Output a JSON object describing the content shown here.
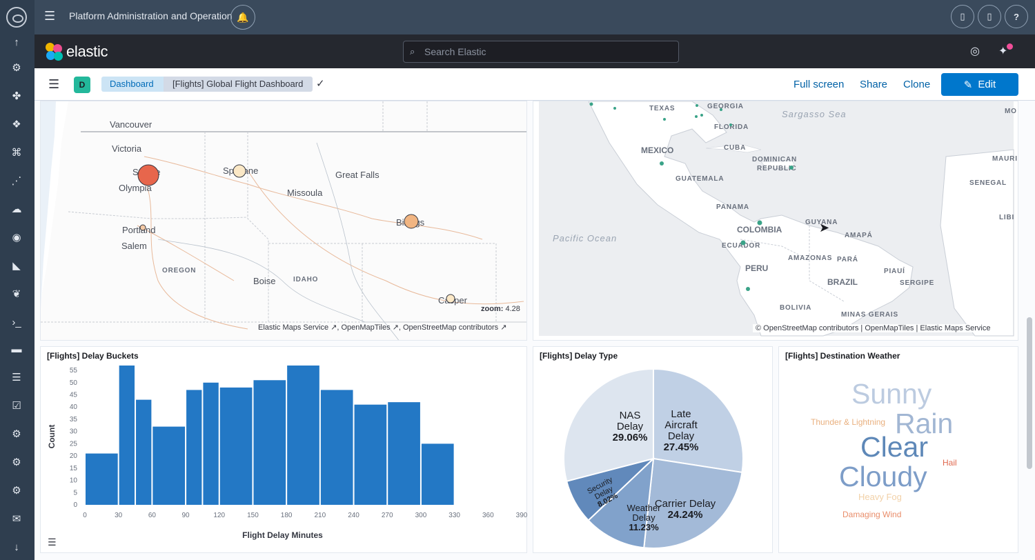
{
  "shell": {
    "title": "Platform Administration and Operation",
    "sidebar_icons": [
      "arrow-up-icon",
      "gear-icon",
      "puzzle-icon",
      "network-icon",
      "graph-icon",
      "share-icon",
      "cloud-icon",
      "target-icon",
      "kibana-icon",
      "leaf-icon",
      "terminal-icon",
      "folder-icon",
      "storage-icon",
      "check-icon",
      "settings-icon",
      "settings-icon",
      "settings-icon",
      "mail-icon",
      "arrow-down-icon"
    ],
    "right_buttons": [
      "document-icon",
      "document-icon",
      "help-icon"
    ],
    "help_label": "?"
  },
  "header": {
    "brand": "elastic",
    "search_placeholder": "Search Elastic"
  },
  "breadcrumbs": {
    "space_initial": "D",
    "items": [
      "Dashboard",
      "[Flights] Global Flight Dashboard"
    ]
  },
  "actions": {
    "full_screen": "Full screen",
    "share": "Share",
    "clone": "Clone",
    "edit": "Edit"
  },
  "map_left": {
    "cities": [
      "Vancouver",
      "Victoria",
      "Seattle",
      "Olympia",
      "Spokane",
      "Great Falls",
      "Missoula",
      "Portland",
      "Salem",
      "Billings",
      "Boise",
      "Casper"
    ],
    "states": [
      "OREGON",
      "IDAHO"
    ],
    "zoom_label": "zoom:",
    "zoom_value": "4.28",
    "attribution": [
      "Elastic Maps Service",
      "OpenMapTiles",
      "OpenStreetMap contributors"
    ]
  },
  "map_right": {
    "labels": [
      "TEXAS",
      "GEORGIA",
      "FLORIDA",
      "MEXICO",
      "CUBA",
      "DOMINICAN",
      "REPUBLIC",
      "GUATEMALA",
      "PANAMA",
      "COLOMBIA",
      "ECUADOR",
      "PERU",
      "AMAZONAS",
      "PARÁ",
      "BRAZIL",
      "GUYANA",
      "AMAPÁ",
      "PIAUÍ",
      "SERGIPE",
      "BOLIVIA",
      "MINAS GERAIS",
      "SENEGAL",
      "MAURI",
      "LIBI",
      "MO"
    ],
    "seas": [
      "Sargasso Sea",
      "Pacific Ocean"
    ],
    "attribution": "© OpenStreetMap contributors | OpenMapTiles | Elastic Maps Service"
  },
  "delay_buckets": {
    "title": "[Flights] Delay Buckets",
    "xlabel": "Flight Delay Minutes",
    "ylabel": "Count",
    "color": "#2378c5"
  },
  "delay_type": {
    "title": "[Flights] Delay Type"
  },
  "destination_weather": {
    "title": "[Flights] Destination Weather",
    "words": [
      {
        "text": "Sunny",
        "color": "#bccbe0"
      },
      {
        "text": "Rain",
        "color": "#a1b6d3"
      },
      {
        "text": "Thunder & Lightning",
        "color": "#e9b07f"
      },
      {
        "text": "Clear",
        "color": "#5e88b8"
      },
      {
        "text": "Hail",
        "color": "#e0694f"
      },
      {
        "text": "Cloudy",
        "color": "#7d9dc8"
      },
      {
        "text": "Heavy Fog",
        "color": "#f2d1a8"
      },
      {
        "text": "Damaging Wind",
        "color": "#e98d6a"
      }
    ]
  },
  "chart_data": [
    {
      "type": "bar",
      "title": "[Flights] Delay Buckets",
      "xlabel": "Flight Delay Minutes",
      "ylabel": "Count",
      "x_ticks": [
        0,
        30,
        60,
        90,
        120,
        150,
        180,
        210,
        240,
        270,
        300,
        330,
        360,
        390
      ],
      "y_ticks": [
        0,
        5,
        10,
        15,
        20,
        25,
        30,
        35,
        40,
        45,
        50,
        55
      ],
      "ylim": [
        0,
        57
      ],
      "bins": [
        0,
        30,
        45,
        60,
        90,
        105,
        120,
        150,
        180,
        210,
        240,
        270,
        300,
        330,
        360,
        390
      ],
      "values": [
        21,
        57,
        43,
        32,
        47,
        50,
        48,
        51,
        57,
        47,
        41,
        42,
        25
      ],
      "grid": false
    },
    {
      "type": "pie",
      "title": "[Flights] Delay Type",
      "slices": [
        {
          "label": "Late Aircraft Delay",
          "value": 27.45,
          "display": "27.45%",
          "color": "#c0d0e5"
        },
        {
          "label": "Carrier Delay",
          "value": 24.24,
          "display": "24.24%",
          "color": "#a3bad8"
        },
        {
          "label": "Weather Delay",
          "value": 11.23,
          "display": "11.23%",
          "color": "#81a2cb"
        },
        {
          "label": "Security Delay",
          "value": 8.02,
          "display": "8.02%",
          "color": "#6189bb"
        },
        {
          "label": "NAS Delay",
          "value": 29.06,
          "display": "29.06%",
          "color": "#dde5ef"
        }
      ]
    }
  ]
}
